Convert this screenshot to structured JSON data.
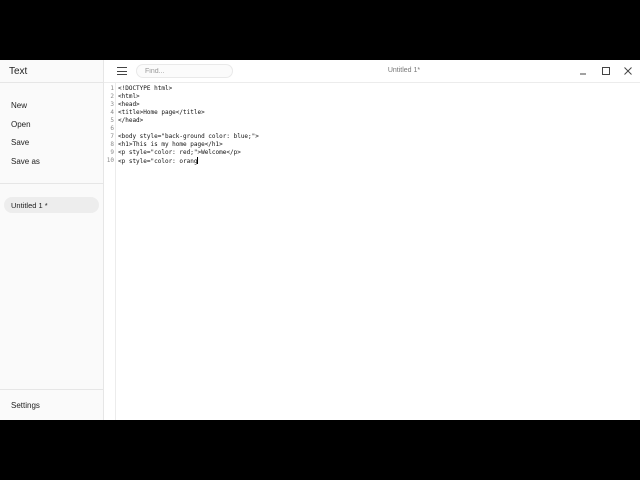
{
  "sidebar": {
    "app_title": "Text",
    "menu": [
      "New",
      "Open",
      "Save",
      "Save as"
    ],
    "documents": [
      "Untitled 1 *"
    ],
    "settings_label": "Settings"
  },
  "header": {
    "menu_icon": "hamburger-icon",
    "find_placeholder": "Find...",
    "document_title": "Untitled 1*",
    "window_controls": [
      "minimize-icon",
      "maximize-icon",
      "close-icon"
    ]
  },
  "editor": {
    "lines": [
      {
        "num": "1",
        "text": "<!DOCTYPE html>"
      },
      {
        "num": "2",
        "text": "<html>"
      },
      {
        "num": "3",
        "text": "<head>"
      },
      {
        "num": "4",
        "text": "<title>Home page</title>"
      },
      {
        "num": "5",
        "text": "</head>"
      },
      {
        "num": "6",
        "text": ""
      },
      {
        "num": "7",
        "text": "<body style=\"back-ground color: blue;\">"
      },
      {
        "num": "8",
        "text": "<h1>This is my home page</h1>"
      },
      {
        "num": "9",
        "text": "<p style=\"color: red;\">Welcome</p>"
      },
      {
        "num": "10",
        "text": "<p style=\"color: orang"
      }
    ]
  }
}
